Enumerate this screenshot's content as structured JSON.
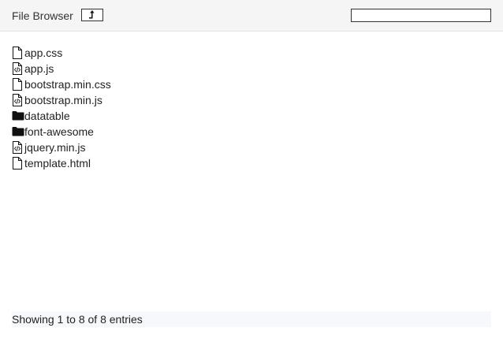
{
  "header": {
    "title": "File Browser",
    "up_icon": "level-up-icon",
    "search_value": ""
  },
  "files": [
    {
      "label": "app.css",
      "icon": "file-icon"
    },
    {
      "label": "app.js",
      "icon": "code-file-icon"
    },
    {
      "label": "bootstrap.min.css",
      "icon": "file-icon"
    },
    {
      "label": "bootstrap.min.js",
      "icon": "code-file-icon"
    },
    {
      "label": "datatable",
      "icon": "folder-icon"
    },
    {
      "label": "font-awesome",
      "icon": "folder-icon"
    },
    {
      "label": "jquery.min.js",
      "icon": "code-file-icon"
    },
    {
      "label": "template.html",
      "icon": "file-icon"
    }
  ],
  "footer": {
    "info": "Showing 1 to 8 of 8 entries"
  },
  "colors": {
    "header_bg": "#f5f5f5",
    "footer_bg": "#f7f8fc"
  }
}
